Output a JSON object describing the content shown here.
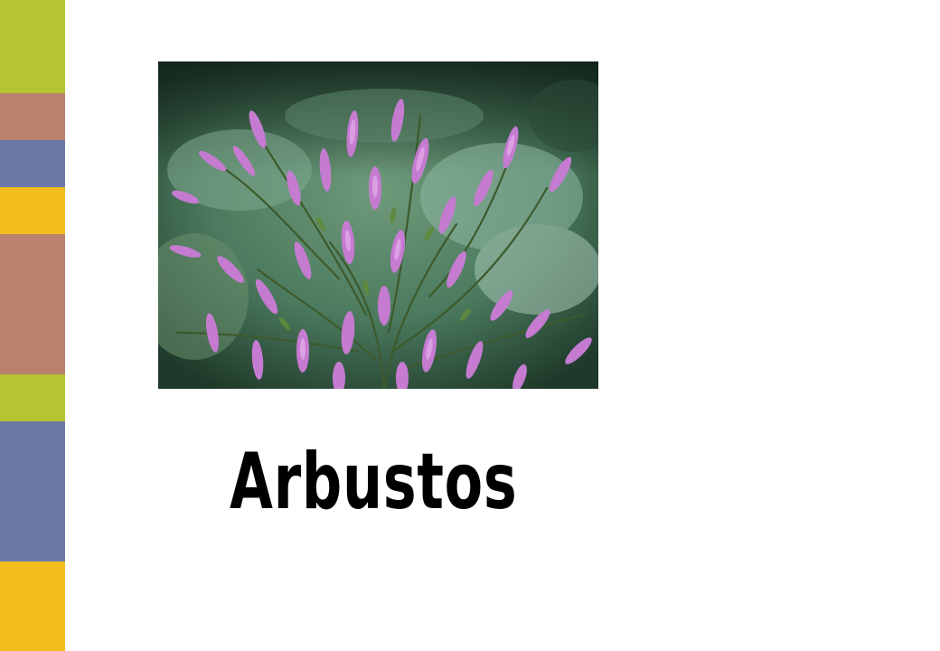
{
  "slide": {
    "title": "Arbustos"
  },
  "photo": {
    "subject": "heather-shrub-photo"
  },
  "colors": {
    "background": "#ffffff",
    "bar_green": "#b5c532",
    "bar_salmon": "#b8826e",
    "bar_blue": "#6e78a8",
    "bar_yellow": "#f2bd1d",
    "title": "#000000"
  }
}
